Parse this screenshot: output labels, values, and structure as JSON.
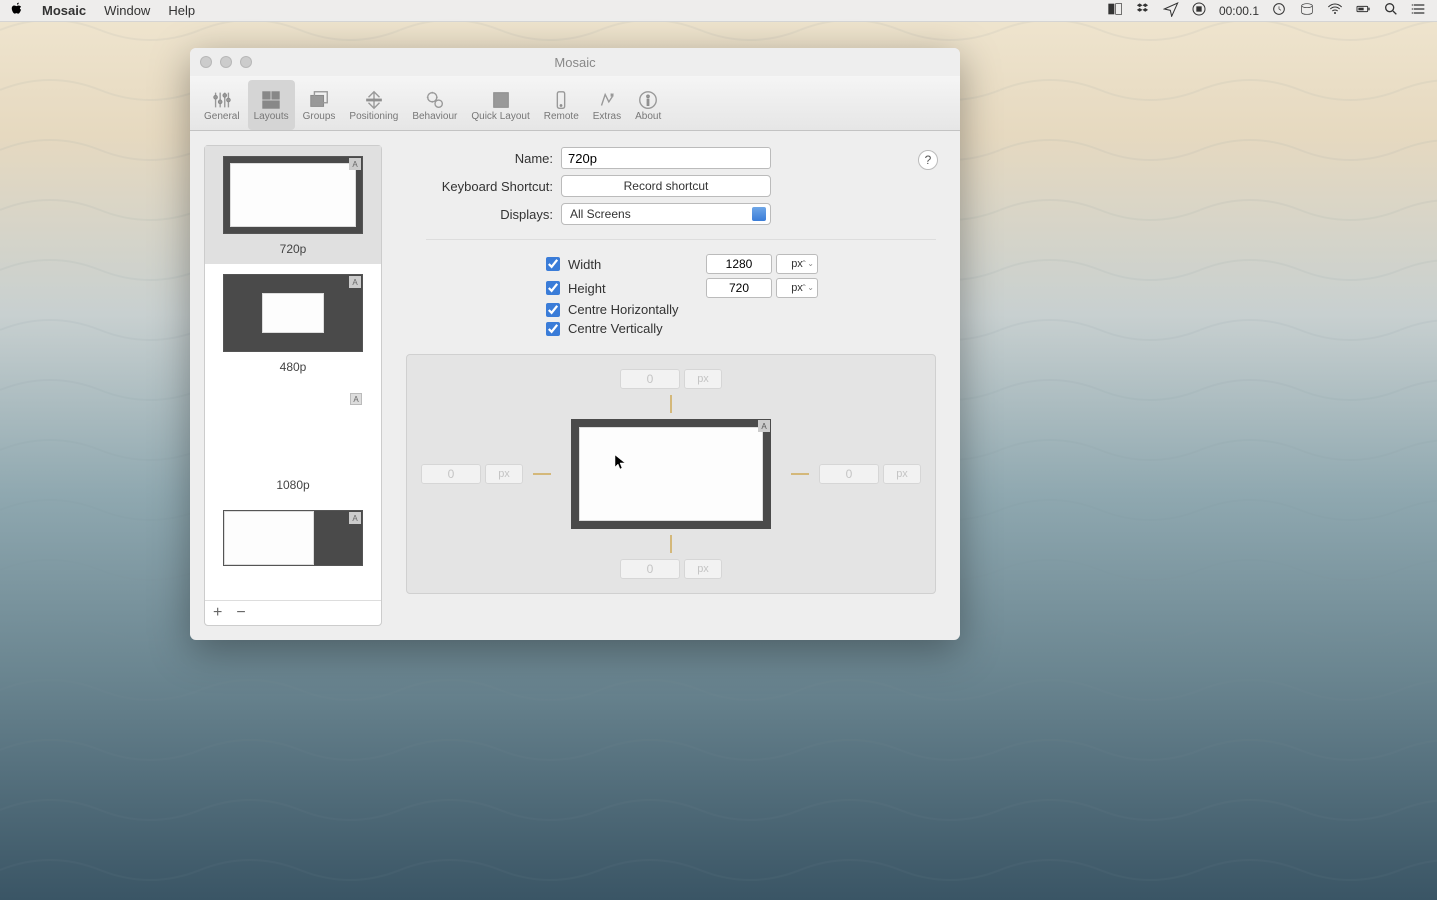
{
  "menubar": {
    "app": "Mosaic",
    "items": [
      "Window",
      "Help"
    ],
    "clock": "00:00.1"
  },
  "window": {
    "title": "Mosaic"
  },
  "toolbar": {
    "items": [
      {
        "label": "General"
      },
      {
        "label": "Layouts"
      },
      {
        "label": "Groups"
      },
      {
        "label": "Positioning"
      },
      {
        "label": "Behaviour"
      },
      {
        "label": "Quick Layout"
      },
      {
        "label": "Remote"
      },
      {
        "label": "Extras"
      },
      {
        "label": "About"
      }
    ],
    "selected": 1
  },
  "sidebar": {
    "items": [
      {
        "label": "720p"
      },
      {
        "label": "480p"
      },
      {
        "label": "1080p"
      },
      {
        "label": ""
      }
    ],
    "add": "+",
    "remove": "−"
  },
  "form": {
    "name_label": "Name:",
    "name_value": "720p",
    "shortcut_label": "Keyboard Shortcut:",
    "shortcut_btn": "Record shortcut",
    "displays_label": "Displays:",
    "displays_value": "All Screens",
    "help": "?",
    "width_label": "Width",
    "width_value": "1280",
    "width_unit": "px",
    "height_label": "Height",
    "height_value": "720",
    "height_unit": "px",
    "centre_h": "Centre Horizontally",
    "centre_v": "Centre Vertically"
  },
  "preview": {
    "top": {
      "value": "0",
      "unit": "px"
    },
    "bottom": {
      "value": "0",
      "unit": "px"
    },
    "left": {
      "value": "0",
      "unit": "px"
    },
    "right": {
      "value": "0",
      "unit": "px"
    },
    "badge": "A"
  }
}
